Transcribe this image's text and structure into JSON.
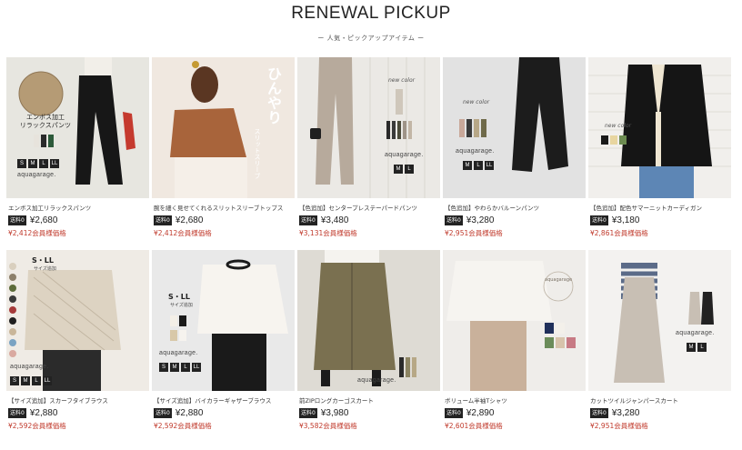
{
  "section": {
    "title": "RENEWAL PICKUP",
    "subtitle": "ー 人気・ピックアップアイテム ー"
  },
  "products": [
    {
      "name": "エンボス加工リラックスパンツ",
      "badge": "送料0",
      "price": "¥2,680",
      "member_price": "¥2,412会員様価格",
      "overlay": "エンボス加工\nリラックスパンツ",
      "brand": "aquagarage.",
      "sizes": [
        "S",
        "M",
        "L",
        "LL"
      ],
      "colors": [
        "#e7e3dc",
        "#d8d2c6",
        "#2a2a2a",
        "#2d5a3a",
        "#c53a2e"
      ]
    },
    {
      "name": "腕を細く見せてくれるスリットスリーブトップス",
      "badge": "送料0",
      "price": "¥2,680",
      "member_price": "¥2,412会員様価格",
      "overlay": "ひんやり",
      "overlay_sub": "スリットスリーブ",
      "colors": [
        "#f0e6de",
        "#a8643b",
        "#6b3a20"
      ]
    },
    {
      "name": "【色追加】センタープレステーパードパンツ",
      "badge": "送料0",
      "price": "¥3,480",
      "member_price": "¥3,131会員様価格",
      "overlay": "new color",
      "brand": "aquagarage.",
      "sizes": [
        "M",
        "L"
      ],
      "colors": [
        "#e8e6e2",
        "#b7aa9c",
        "#1f1f1f"
      ]
    },
    {
      "name": "【色追加】やわらかバルーンパンツ",
      "badge": "送料0",
      "price": "¥3,280",
      "member_price": "¥2,951会員様価格",
      "overlay": "new color",
      "brand": "aquagarage.",
      "sizes": [
        "M",
        "L",
        "LL"
      ],
      "colors": [
        "#dcdcdc",
        "#1c1c1c",
        "#a98c7c"
      ]
    },
    {
      "name": "【色追加】配色サマーニットカーディガン",
      "badge": "送料0",
      "price": "¥3,180",
      "member_price": "¥2,861会員様価格",
      "overlay": "new color",
      "colors": [
        "#f3f1ee",
        "#151515",
        "#efe6d2"
      ]
    },
    {
      "name": "【サイズ追加】スカーフタイブラウス",
      "badge": "送料0",
      "price": "¥2,880",
      "member_price": "¥2,592会員様価格",
      "overlay": "S・LL",
      "overlay_sub": "サイズ追加",
      "brand": "aquagarage.",
      "sizes": [
        "S",
        "M",
        "L",
        "LL"
      ],
      "colors": [
        "#efe9df",
        "#ddd3c2",
        "#2b2b2b"
      ]
    },
    {
      "name": "【サイズ追加】バイカラーギャザーブラウス",
      "badge": "送料0",
      "price": "¥2,880",
      "member_price": "¥2,592会員様価格",
      "overlay": "S・LL",
      "overlay_sub": "サイズ追加",
      "brand": "aquagarage.",
      "sizes": [
        "S",
        "M",
        "L",
        "LL"
      ],
      "colors": [
        "#e9e9e9",
        "#f7f4ef",
        "#1a1a1a"
      ]
    },
    {
      "name": "前ZIPロングカーゴスカート",
      "badge": "送料0",
      "price": "¥3,980",
      "member_price": "¥3,582会員様価格",
      "brand": "aquagarage.",
      "colors": [
        "#dedbd4",
        "#7a7050",
        "#8c8462"
      ]
    },
    {
      "name": "ボリューム半袖Tシャツ",
      "badge": "送料0",
      "price": "¥2,890",
      "member_price": "¥2,601会員様価格",
      "overlay": "aquagarage",
      "colors": [
        "#efedea",
        "#f6f4f0",
        "#c9b19b"
      ]
    },
    {
      "name": "カットツイルジャンパースカート",
      "badge": "送料0",
      "price": "¥3,280",
      "member_price": "¥2,951会員様価格",
      "brand": "aquagarage.",
      "sizes": [
        "M",
        "L"
      ],
      "colors": [
        "#f3f2f0",
        "#c8bfb4",
        "#222222"
      ]
    }
  ]
}
